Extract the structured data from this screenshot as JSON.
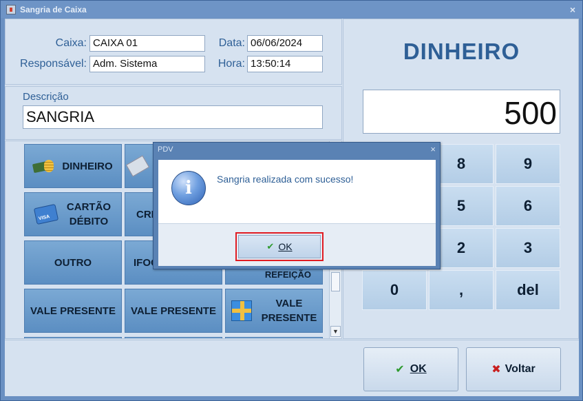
{
  "window": {
    "title": "Sangria de Caixa",
    "close_glyph": "×"
  },
  "header": {
    "caixa_label": "Caixa:",
    "caixa_value": "CAIXA 01",
    "data_label": "Data:",
    "data_value": "06/06/2024",
    "responsavel_label": "Responsável:",
    "responsavel_value": "Adm. Sistema",
    "hora_label": "Hora:",
    "hora_value": "13:50:14"
  },
  "descricao": {
    "label": "Descrição",
    "value": "SANGRIA"
  },
  "payment_buttons": [
    {
      "label": "DINHEIRO",
      "icon": "cash-coins-icon"
    },
    {
      "label": "",
      "icon": "check-icon"
    },
    {
      "label": "CARTÃO\nDÉBITO",
      "icon": "credit-card-icon"
    },
    {
      "label": "CRÉ",
      "icon": ""
    },
    {
      "label": "OUTRO",
      "icon": ""
    },
    {
      "label": "IFOO",
      "icon": ""
    },
    {
      "label": "REFEIÇÃO",
      "icon": ""
    },
    {
      "label": "VALE PRESENTE",
      "icon": ""
    },
    {
      "label": "VALE PRESENTE",
      "icon": ""
    },
    {
      "label": "VALE\nPRESENTE",
      "icon": "gift-icon"
    }
  ],
  "right": {
    "payment_type": "DINHEIRO",
    "amount": "500",
    "keys": [
      "8",
      "9",
      "5",
      "6",
      "2",
      "3",
      "0",
      ",",
      "del"
    ]
  },
  "actions": {
    "ok_label": "OK",
    "voltar_label": "Voltar"
  },
  "dialog": {
    "title": "PDV",
    "message": "Sangria realizada com sucesso!",
    "ok_label": "OK",
    "info_glyph": "i"
  },
  "colors": {
    "accent": "#2e5f96",
    "button_blue": "#6b9cce",
    "highlight": "#e01b22"
  }
}
